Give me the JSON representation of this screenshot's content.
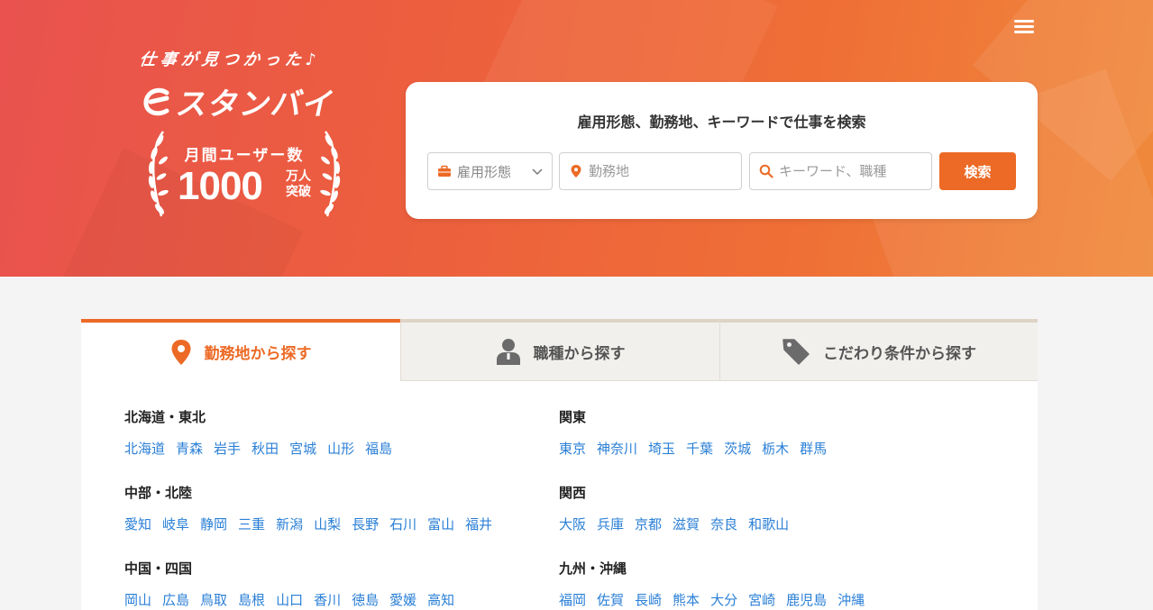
{
  "brand": {
    "tagline": "仕事が見つかった♪",
    "logo_text": "スタンバイ",
    "badge_top": "月間ユーザー数",
    "badge_number": "1000",
    "badge_unit": "万人突破"
  },
  "menu": {
    "icon": "hamburger-icon"
  },
  "search": {
    "title": "雇用形態、勤務地、キーワードで仕事を検索",
    "employment_label": "雇用形態",
    "location_placeholder": "勤務地",
    "keyword_placeholder": "キーワード、職種",
    "button_label": "検索"
  },
  "tabs": [
    {
      "label": "勤務地から探す",
      "icon": "location-pin-icon",
      "active": true
    },
    {
      "label": "職種から探す",
      "icon": "person-icon",
      "active": false
    },
    {
      "label": "こだわり条件から探す",
      "icon": "tag-icon",
      "active": false
    }
  ],
  "regions": [
    {
      "title": "北海道・東北",
      "prefectures": [
        "北海道",
        "青森",
        "岩手",
        "秋田",
        "宮城",
        "山形",
        "福島"
      ]
    },
    {
      "title": "関東",
      "prefectures": [
        "東京",
        "神奈川",
        "埼玉",
        "千葉",
        "茨城",
        "栃木",
        "群馬"
      ]
    },
    {
      "title": "中部・北陸",
      "prefectures": [
        "愛知",
        "岐阜",
        "静岡",
        "三重",
        "新潟",
        "山梨",
        "長野",
        "石川",
        "富山",
        "福井"
      ]
    },
    {
      "title": "関西",
      "prefectures": [
        "大阪",
        "兵庫",
        "京都",
        "滋賀",
        "奈良",
        "和歌山"
      ]
    },
    {
      "title": "中国・四国",
      "prefectures": [
        "岡山",
        "広島",
        "鳥取",
        "島根",
        "山口",
        "香川",
        "徳島",
        "愛媛",
        "高知"
      ]
    },
    {
      "title": "九州・沖縄",
      "prefectures": [
        "福岡",
        "佐賀",
        "長崎",
        "熊本",
        "大分",
        "宮崎",
        "鹿児島",
        "沖縄"
      ]
    }
  ],
  "colors": {
    "accent": "#ec6a25",
    "link": "#2a7fd6"
  }
}
